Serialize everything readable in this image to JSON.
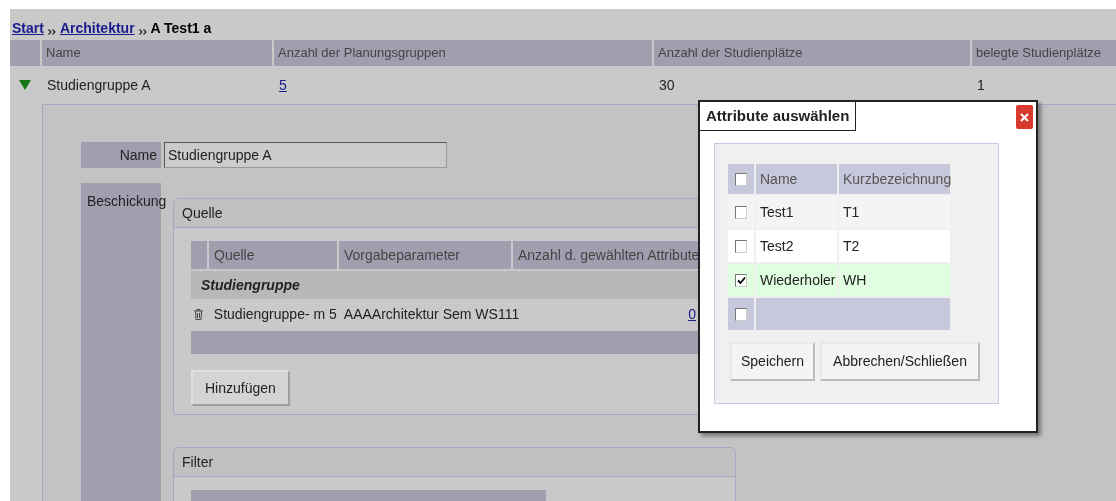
{
  "breadcrumb": [
    {
      "label": "Start",
      "kind": "link"
    },
    {
      "label": "Architektur",
      "kind": "link"
    },
    {
      "label": "A Test1 a",
      "kind": "current"
    }
  ],
  "table": {
    "columns": [
      "Name",
      "Anzahl der Planungsgruppen",
      "Anzahl der Studienplätze",
      "belegte Studienplätze"
    ],
    "rows": [
      {
        "expanded": true,
        "cells": [
          "Studiengruppe A",
          "5",
          "30",
          "1"
        ]
      }
    ]
  },
  "detail": {
    "name_label": "Name",
    "name_value": "Studiengruppe A",
    "beschickung_label": "Beschickung",
    "quelle": {
      "title": "Quelle",
      "columns": [
        "Quelle",
        "Vorgabeparameter",
        "Anzahl d. gewählten Attribute"
      ],
      "group": "Studiengruppe",
      "rows": [
        {
          "cells": [
            "Studiengruppe- m 5",
            "AAAArchitektur Sem WS111",
            "0"
          ]
        }
      ],
      "add_button": "Hinzufügen"
    },
    "filter": {
      "title": "Filter"
    }
  },
  "dialog": {
    "title": "Attribute auswählen",
    "columns": [
      "Name",
      "Kurzbezeichnung"
    ],
    "header_checked": false,
    "rows": [
      {
        "name": "Test1",
        "short": "T1",
        "checked": false
      },
      {
        "name": "Test2",
        "short": "T2",
        "checked": false
      },
      {
        "name": "Wiederholer",
        "short": "WH",
        "checked": true
      },
      {
        "name": "",
        "short": "",
        "checked": false
      }
    ],
    "buttons": [
      "Speichern",
      "Abbrechen/Schließen"
    ]
  }
}
